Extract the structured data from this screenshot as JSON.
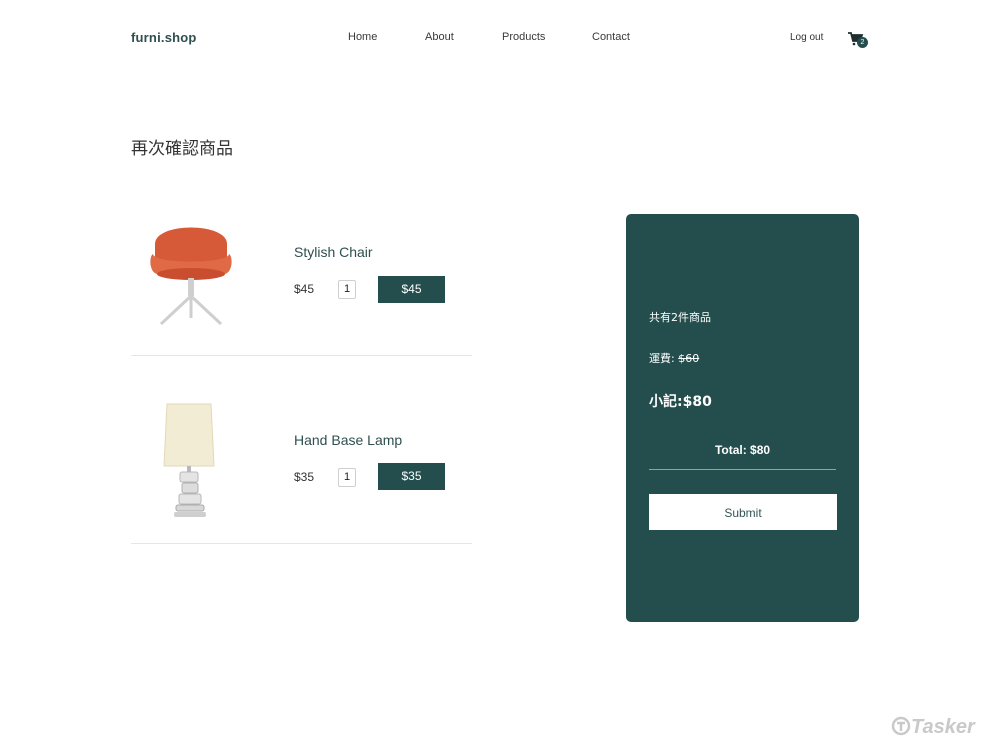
{
  "header": {
    "logo": "furni.shop",
    "nav": [
      "Home",
      "About",
      "Products",
      "Contact"
    ],
    "logout": "Log out",
    "cart_count": "2"
  },
  "page_title": "再次確認商品",
  "items": [
    {
      "name": "Stylish Chair",
      "price": "$45",
      "qty": "1",
      "total": "$45",
      "image": "chair-image"
    },
    {
      "name": "Hand Base Lamp",
      "price": "$35",
      "qty": "1",
      "total": "$35",
      "image": "lamp-image"
    }
  ],
  "summary": {
    "count_text": "共有2件商品",
    "ship_label": "運費: ",
    "ship_value": "$60",
    "subtotal": "小記:$80",
    "total": "Total: $80",
    "submit": "Submit"
  },
  "watermark": "Tasker",
  "colors": {
    "accent": "#244e4e"
  }
}
